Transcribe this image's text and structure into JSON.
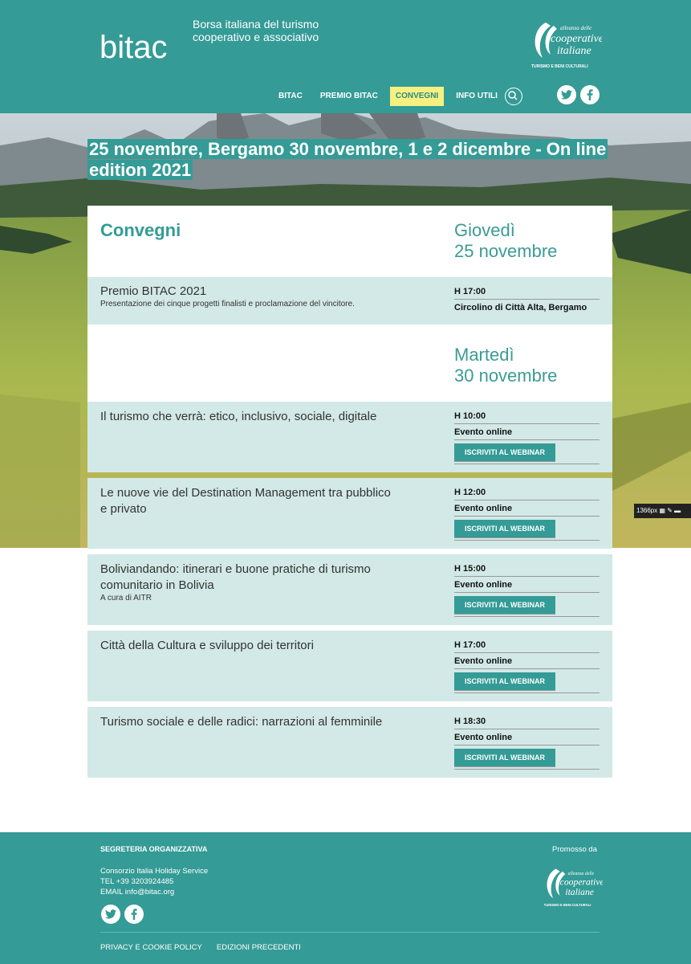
{
  "header": {
    "logo_text": "bitac",
    "tagline": "Borsa italiana del turismo cooperativo e associativo",
    "partner_logo": {
      "line1": "alleanza delle",
      "line2": "cooperative",
      "line3": "italiane",
      "line4": "TURISMO E BENI CULTURALI"
    },
    "nav": [
      {
        "label": "BITAC"
      },
      {
        "label": "PREMIO BITAC"
      },
      {
        "label": "CONVEGNI",
        "active": true
      },
      {
        "label": "INFO UTILI"
      }
    ],
    "colors": {
      "brand": "#349b96",
      "active_bg": "#f5f080"
    }
  },
  "hero": {
    "title": "25 novembre, Bergamo 30 novembre, 1 e 2 dicembre - On line edition 2021"
  },
  "section_heading": "Convegni",
  "days": [
    {
      "day_name": "Giovedì",
      "day_date": "25 novembre",
      "events": [
        {
          "title": "Premio BITAC 2021",
          "subtitle": "Presentazione dei cinque progetti finalisti e proclamazione del vincitore.",
          "time": "H 17:00",
          "place": "Circolino di Città Alta, Bergamo"
        }
      ]
    },
    {
      "day_name": "Martedì",
      "day_date": "30 novembre",
      "events": [
        {
          "title": "Il turismo che verrà: etico, inclusivo, sociale, digitale",
          "time": "H 10:00",
          "place": "Evento online",
          "button": "ISCRIVITI AL WEBINAR"
        },
        {
          "title": "Le nuove vie del Destination Management tra pubblico e privato",
          "time": "H 12:00",
          "place": "Evento online",
          "button": "ISCRIVITI AL WEBINAR"
        },
        {
          "title": "Boliviandando: itinerari e buone pratiche di turismo comunitario in Bolivia",
          "subtitle": "A cura di AITR",
          "time": "H 15:00",
          "place": "Evento online",
          "button": "ISCRIVITI AL WEBINAR"
        },
        {
          "title": "Città della Cultura e sviluppo dei territori",
          "time": "H 17:00",
          "place": "Evento online",
          "button": "ISCRIVITI AL WEBINAR"
        },
        {
          "title": "Turismo sociale e delle radici: narrazioni al femminile",
          "time": "H 18:30",
          "place": "Evento online",
          "button": "ISCRIVITI AL WEBINAR"
        }
      ]
    }
  ],
  "side_badge": "1366px",
  "footer": {
    "heading": "SEGRETERIA ORGANIZZATIVA",
    "org": "Consorzio Italia Holiday Service",
    "tel": "TEL +39 3203924485",
    "email": "EMAIL info@bitac.org",
    "promoted_by": "Promosso da",
    "links": [
      "PRIVACY E COOKIE POLICY",
      "EDIZIONI PRECEDENTI"
    ]
  }
}
